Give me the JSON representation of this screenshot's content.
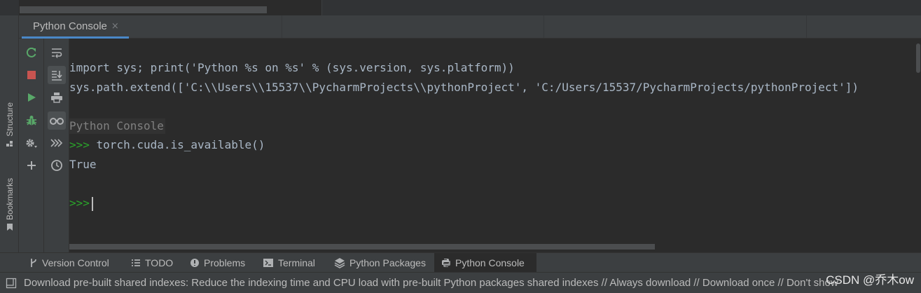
{
  "tool_window": {
    "title": "Python Console",
    "close_glyph": "×"
  },
  "left_stripe": {
    "structure_label": "Structure",
    "bookmarks_label": "Bookmarks"
  },
  "run_toolbar": {
    "icons": [
      "rerun-icon",
      "stop-icon",
      "run-icon",
      "debug-icon",
      "settings-icon",
      "add-icon"
    ]
  },
  "control_toolbar": {
    "icons": [
      "soft-wrap-icon",
      "scroll-to-end-icon",
      "print-icon",
      "show-variables-icon",
      "execute-icon",
      "history-icon"
    ]
  },
  "console": {
    "lines": [
      "import sys; print('Python %s on %s' % (sys.version, sys.platform))",
      "sys.path.extend(['C:\\\\Users\\\\15537\\\\PycharmProjects\\\\pythonProject', 'C:/Users/15537/PycharmProjects/pythonProject'])"
    ],
    "banner": "Python Console",
    "prompt": ">>>",
    "command": " torch.cuda.is_available()",
    "output": "True"
  },
  "bottom_tabs": [
    {
      "label": "Version Control",
      "icon": "branch-icon"
    },
    {
      "label": "TODO",
      "icon": "list-icon"
    },
    {
      "label": "Problems",
      "icon": "warning-icon"
    },
    {
      "label": "Terminal",
      "icon": "terminal-icon"
    },
    {
      "label": "Python Packages",
      "icon": "layers-icon"
    },
    {
      "label": "Python Console",
      "icon": "python-icon"
    }
  ],
  "status_bar": {
    "message": "Download pre-built shared indexes: Reduce the indexing time and CPU load with pre-built Python packages shared indexes // Always download // Download once // Don't show"
  },
  "watermark": "CSDN @乔木ow",
  "colors": {
    "background": "#2b2b2b",
    "panel": "#3c3f41",
    "accent": "#4a88c7",
    "prompt": "#2aa52a",
    "run_green": "#59a869",
    "stop_red": "#c75450"
  }
}
